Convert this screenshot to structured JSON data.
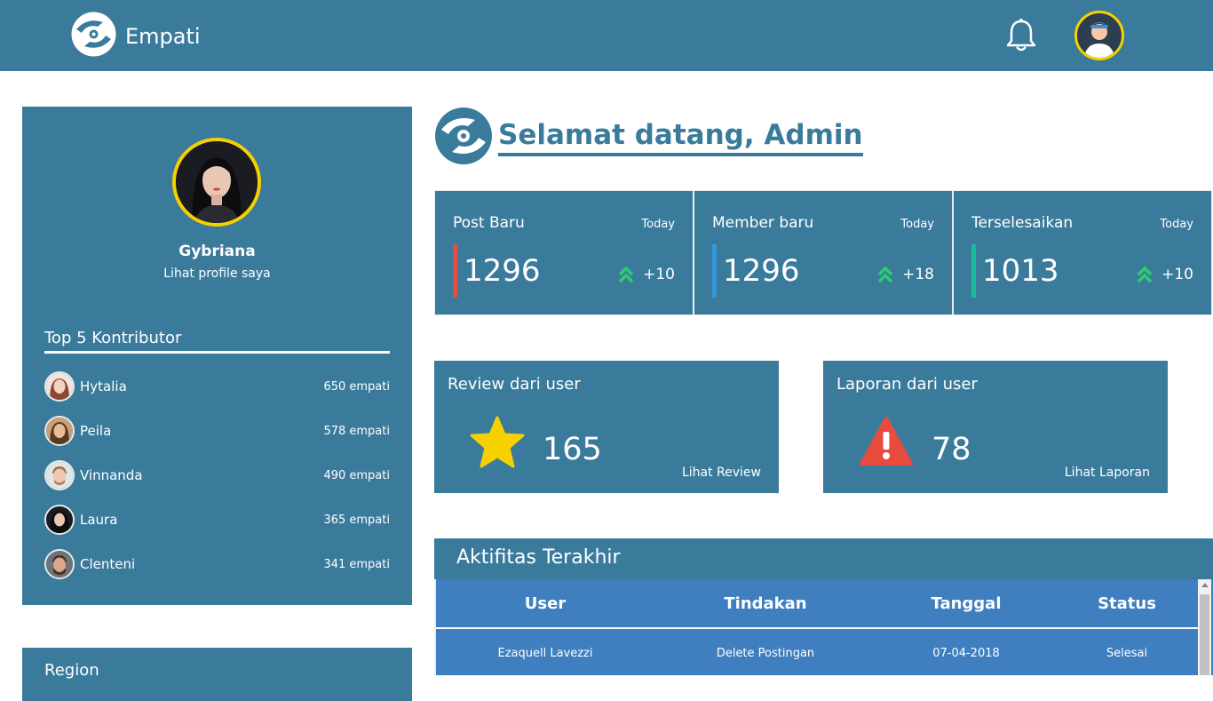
{
  "header": {
    "brand": "Empati",
    "notification_icon": "bell-icon"
  },
  "profile": {
    "name": "Gybriana",
    "link_label": "Lihat profile saya"
  },
  "contributors": {
    "title": "Top 5 Kontributor",
    "items": [
      {
        "name": "Hytalia",
        "score": "650 empati"
      },
      {
        "name": "Peila",
        "score": "578 empati"
      },
      {
        "name": "Vinnanda",
        "score": "490 empati"
      },
      {
        "name": "Laura",
        "score": "365 empati"
      },
      {
        "name": "Clenteni",
        "score": "341 empati"
      }
    ]
  },
  "region": {
    "title": "Region"
  },
  "welcome": {
    "title": "Selamat datang, Admin"
  },
  "stats": [
    {
      "label": "Post Baru",
      "period": "Today",
      "value": "1296",
      "delta": "+10",
      "accent": "#e74c3c"
    },
    {
      "label": "Member baru",
      "period": "Today",
      "value": "1296",
      "delta": "+18",
      "accent": "#3498db"
    },
    {
      "label": "Terselesaikan",
      "period": "Today",
      "value": "1013",
      "delta": "+10",
      "accent": "#1abc9c"
    }
  ],
  "review": {
    "title": "Review dari user",
    "value": "165",
    "link": "Lihat Review"
  },
  "report": {
    "title": "Laporan dari user",
    "value": "78",
    "link": "Lihat Laporan"
  },
  "activity": {
    "title": "Aktifitas Terakhir",
    "columns": [
      "User",
      "Tindakan",
      "Tanggal",
      "Status"
    ],
    "rows": [
      {
        "user": "Ezaquell Lavezzi",
        "action": "Delete Postingan",
        "date": "07-04-2018",
        "status": "Selesai"
      }
    ]
  },
  "colors": {
    "primary": "#3a7b9c",
    "highlight": "#f7d000",
    "up_arrow": "#2ecc71",
    "table_blue": "#3f7fbf"
  }
}
